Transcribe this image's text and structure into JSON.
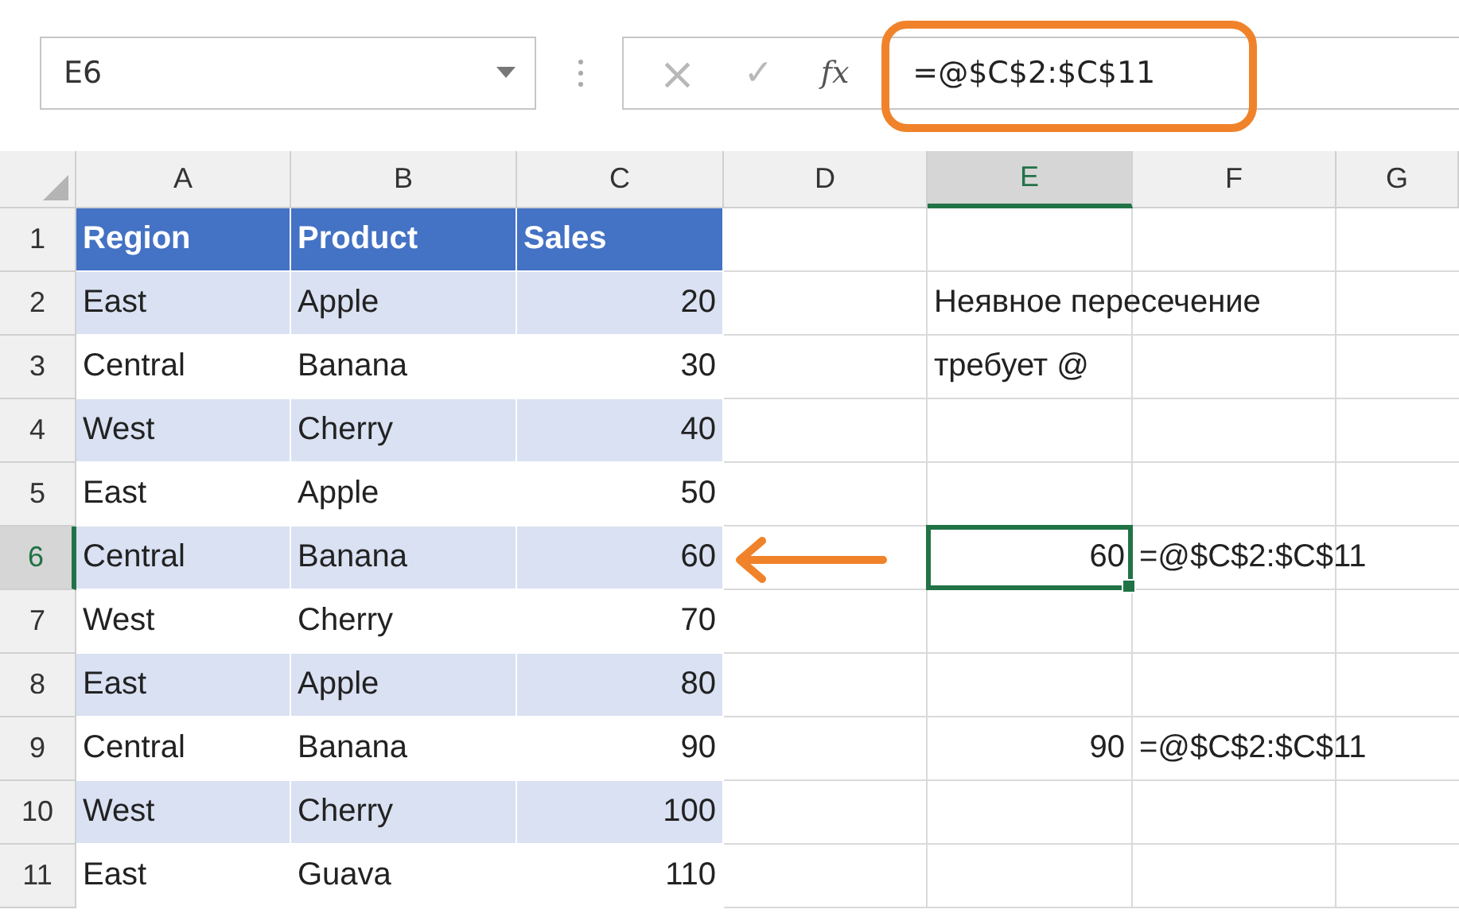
{
  "formula_bar": {
    "name_box": "E6",
    "cancel_icon": "×",
    "enter_icon": "✓",
    "function_icon": "fx",
    "formula": "=@$C$2:$C$11",
    "highlighted": true
  },
  "columns": [
    {
      "label": "A",
      "selected": false
    },
    {
      "label": "B",
      "selected": false
    },
    {
      "label": "C",
      "selected": false
    },
    {
      "label": "D",
      "selected": false
    },
    {
      "label": "E",
      "selected": true
    },
    {
      "label": "F",
      "selected": false
    },
    {
      "label": "G",
      "selected": false
    }
  ],
  "rows": [
    {
      "number": "1",
      "selected": false,
      "kind": "header",
      "table_cells": [
        "Region",
        "Product",
        "Sales"
      ]
    },
    {
      "number": "2",
      "selected": false,
      "kind": "data",
      "table_cells": [
        "East",
        "Apple",
        "20"
      ],
      "column_e": {
        "text": "Неявное пересечение",
        "kind": "text",
        "active": false
      }
    },
    {
      "number": "3",
      "selected": false,
      "kind": "data",
      "table_cells": [
        "Central",
        "Banana",
        "30"
      ],
      "column_e": {
        "text": "требует @",
        "kind": "text",
        "active": false
      }
    },
    {
      "number": "4",
      "selected": false,
      "kind": "data",
      "table_cells": [
        "West",
        "Cherry",
        "40"
      ]
    },
    {
      "number": "5",
      "selected": false,
      "kind": "data",
      "table_cells": [
        "East",
        "Apple",
        "50"
      ]
    },
    {
      "number": "6",
      "selected": true,
      "kind": "data",
      "table_cells": [
        "Central",
        "Banana",
        "60"
      ],
      "arrow": true,
      "column_e": {
        "text": "60",
        "kind": "number",
        "active": true
      },
      "column_f": "=@$C$2:$C$11"
    },
    {
      "number": "7",
      "selected": false,
      "kind": "data",
      "table_cells": [
        "West",
        "Cherry",
        "70"
      ]
    },
    {
      "number": "8",
      "selected": false,
      "kind": "data",
      "table_cells": [
        "East",
        "Apple",
        "80"
      ]
    },
    {
      "number": "9",
      "selected": false,
      "kind": "data",
      "table_cells": [
        "Central",
        "Banana",
        "90"
      ],
      "column_e": {
        "text": "90",
        "kind": "number",
        "active": false
      },
      "column_f": "=@$C$2:$C$11"
    },
    {
      "number": "10",
      "selected": false,
      "kind": "data",
      "table_cells": [
        "West",
        "Cherry",
        "100"
      ]
    },
    {
      "number": "11",
      "selected": false,
      "kind": "data",
      "table_cells": [
        "East",
        "Guava",
        "110"
      ]
    }
  ]
}
